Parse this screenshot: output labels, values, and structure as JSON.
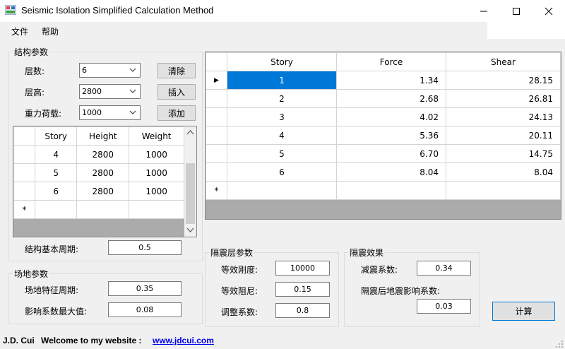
{
  "window": {
    "title": "Seismic Isolation Simplified Calculation Method",
    "controls": [
      "minimize-icon",
      "maximize-icon",
      "close-icon"
    ]
  },
  "menu": [
    {
      "label": "文件"
    },
    {
      "label": "帮助"
    }
  ],
  "structure": {
    "group_title": "结构参数",
    "floors_label": "层数:",
    "floors_value": "6",
    "height_label": "层高:",
    "height_value": "2800",
    "load_label": "重力荷载:",
    "load_value": "1000",
    "clear_button": "清除",
    "insert_button": "插入",
    "add_button": "添加",
    "columns": [
      "Story",
      "Height",
      "Weight"
    ],
    "rows": [
      {
        "story": "4",
        "height": "2800",
        "weight": "1000"
      },
      {
        "story": "5",
        "height": "2800",
        "weight": "1000"
      },
      {
        "story": "6",
        "height": "2800",
        "weight": "1000"
      }
    ],
    "new_row_marker": "*",
    "period_label": "结构基本周期:",
    "period_value": "0.5"
  },
  "site": {
    "group_title": "场地参数",
    "char_period_label": "场地特征周期:",
    "char_period_value": "0.35",
    "max_coef_label": "影响系数最大值:",
    "max_coef_value": "0.08"
  },
  "isolation": {
    "group_title": "隔震层参数",
    "stiffness_label": "等效刚度:",
    "stiffness_value": "10000",
    "damping_label": "等效阻尼:",
    "damping_value": "0.15",
    "adjust_label": "调整系数:",
    "adjust_value": "0.8"
  },
  "effect": {
    "group_title": "隔震效果",
    "reduction_label": "减震系数:",
    "reduction_value": "0.34",
    "after_label": "隔震后地震影响系数:",
    "after_value": "0.03"
  },
  "calc_button": "计算",
  "results": {
    "columns": [
      "Story",
      "Force",
      "Shear"
    ],
    "rows": [
      {
        "story": "1",
        "force": "1.34",
        "shear": "28.15"
      },
      {
        "story": "2",
        "force": "2.68",
        "shear": "26.81"
      },
      {
        "story": "3",
        "force": "4.02",
        "shear": "24.13"
      },
      {
        "story": "4",
        "force": "5.36",
        "shear": "20.11"
      },
      {
        "story": "5",
        "force": "6.70",
        "shear": "14.75"
      },
      {
        "story": "6",
        "force": "8.04",
        "shear": "8.04"
      }
    ],
    "current_row_marker": "▶",
    "new_row_marker": "*"
  },
  "status": {
    "author": "J.D. Cui",
    "welcome": "Welcome to my website :",
    "website": "www.jdcui.com"
  },
  "colors": {
    "selection": "#0078d7",
    "grid_empty": "#ababab",
    "client_bg": "#f0f0f0",
    "link": "#0000ee"
  }
}
